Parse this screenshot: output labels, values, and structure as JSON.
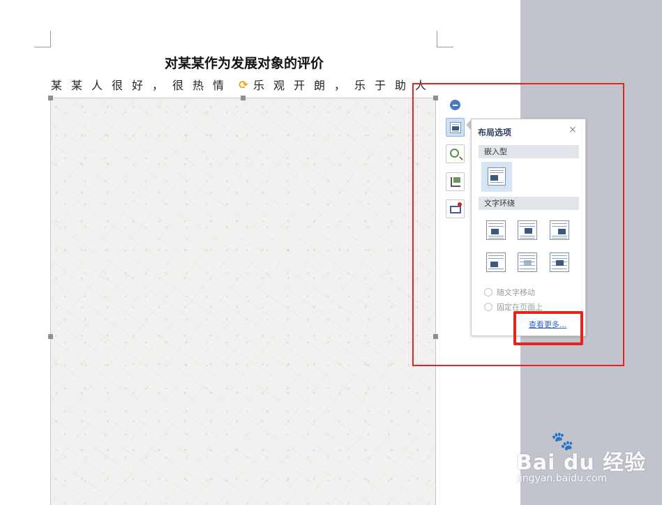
{
  "document": {
    "title": "对某某作为发展对象的评价",
    "first_line_chars": [
      "某",
      "某",
      "人",
      "很",
      "好",
      "，",
      "很",
      "热",
      "情",
      "",
      "乐",
      "观",
      "开",
      "朗",
      "，",
      "乐",
      "于",
      "助",
      "人"
    ]
  },
  "layout_panel": {
    "title": "布局选项",
    "close_icon": "×",
    "section_inline": "嵌入型",
    "section_wrap": "文字环绕",
    "radio_move_with_text": "随文字移动",
    "radio_fix_on_page": "固定在页面上",
    "see_more": "查看更多..."
  },
  "side_toolbar": {
    "buttons": [
      "collapse-icon",
      "layout-options-icon",
      "zoom-icon",
      "crop-icon",
      "picture-frame-icon"
    ]
  },
  "watermark": {
    "main": "Bai du 经验",
    "sub": "jingyan.baidu.com"
  },
  "colors": {
    "annotation_red": "#e8231b",
    "link_blue": "#2a62c9",
    "accent_blue": "#4a78c2"
  }
}
